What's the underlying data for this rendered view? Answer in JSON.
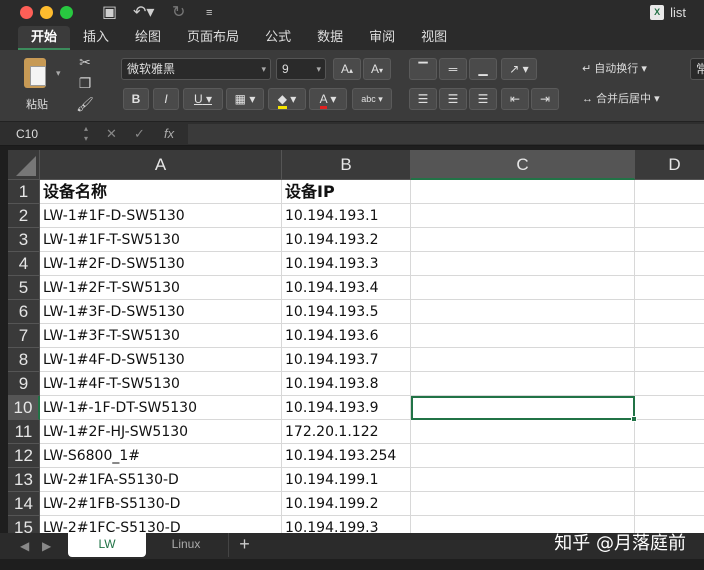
{
  "window": {
    "title": "list",
    "app_badge": "X"
  },
  "ribbon_tabs": [
    "开始",
    "插入",
    "绘图",
    "页面布局",
    "公式",
    "数据",
    "审阅",
    "视图"
  ],
  "ribbon": {
    "paste_label": "粘贴",
    "font_name": "微软雅黑",
    "font_size": "9",
    "grow_font": "A",
    "shrink_font": "A",
    "bold": "B",
    "italic": "I",
    "underline": "U",
    "font_color_letter": "A",
    "phonetic": "abc",
    "wrap_text": "自动换行",
    "merge_center": "合并后居中",
    "number_format_partial": "常"
  },
  "formula_bar": {
    "cell_ref": "C10",
    "fx": "fx",
    "content": ""
  },
  "grid": {
    "columns": [
      "A",
      "B",
      "C",
      "D"
    ],
    "selected_column": "C",
    "selected_row": "10",
    "rows": [
      {
        "num": "1",
        "a": "设备名称",
        "b": "设备IP"
      },
      {
        "num": "2",
        "a": "LW-1#1F-D-SW5130",
        "b": "10.194.193.1"
      },
      {
        "num": "3",
        "a": "LW-1#1F-T-SW5130",
        "b": "10.194.193.2"
      },
      {
        "num": "4",
        "a": "LW-1#2F-D-SW5130",
        "b": "10.194.193.3"
      },
      {
        "num": "5",
        "a": "LW-1#2F-T-SW5130",
        "b": "10.194.193.4"
      },
      {
        "num": "6",
        "a": "LW-1#3F-D-SW5130",
        "b": "10.194.193.5"
      },
      {
        "num": "7",
        "a": "LW-1#3F-T-SW5130",
        "b": "10.194.193.6"
      },
      {
        "num": "8",
        "a": "LW-1#4F-D-SW5130",
        "b": "10.194.193.7"
      },
      {
        "num": "9",
        "a": "LW-1#4F-T-SW5130",
        "b": "10.194.193.8"
      },
      {
        "num": "10",
        "a": "LW-1#-1F-DT-SW5130",
        "b": "10.194.193.9"
      },
      {
        "num": "11",
        "a": "LW-1#2F-HJ-SW5130",
        "b": "172.20.1.122"
      },
      {
        "num": "12",
        "a": "LW-S6800_1#",
        "b": "10.194.193.254"
      },
      {
        "num": "13",
        "a": "LW-2#1FA-S5130-D",
        "b": "10.194.199.1"
      },
      {
        "num": "14",
        "a": "LW-2#1FB-S5130-D",
        "b": "10.194.199.2"
      },
      {
        "num": "15",
        "a": "LW-2#1FC-S5130-D",
        "b": "10.194.199.3"
      }
    ]
  },
  "sheets": [
    "LW",
    "Linux"
  ],
  "add_sheet": "+",
  "watermark": "知乎 @月落庭前",
  "colors": {
    "accent": "#217346",
    "chrome_dark": "#2b2b2b",
    "ribbon_bg": "#3b3b3b"
  }
}
